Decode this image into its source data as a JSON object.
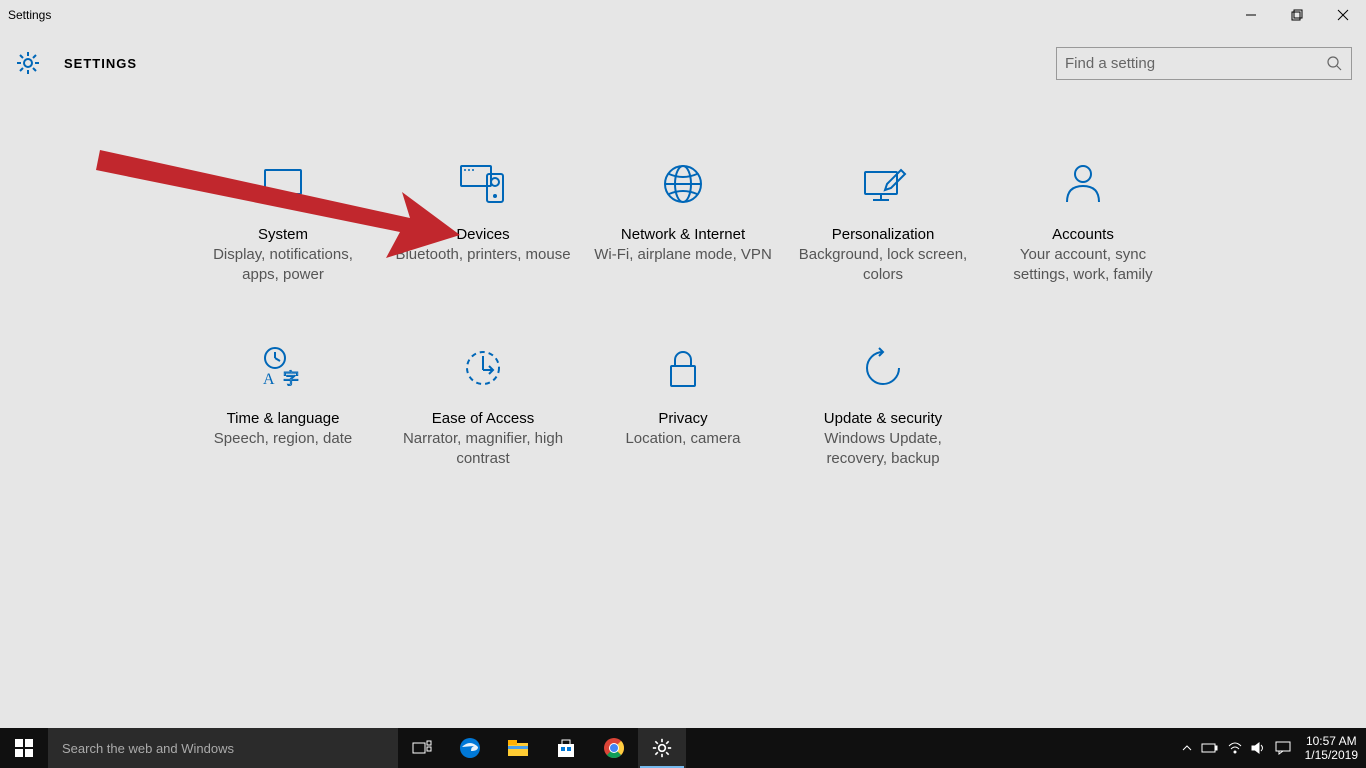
{
  "window": {
    "title": "Settings"
  },
  "header": {
    "app_title": "SETTINGS"
  },
  "search": {
    "placeholder": "Find a setting"
  },
  "colors": {
    "accent": "#0067b8"
  },
  "tiles": [
    {
      "id": "system",
      "title": "System",
      "desc": "Display, notifications, apps, power",
      "icon": "monitor"
    },
    {
      "id": "devices",
      "title": "Devices",
      "desc": "Bluetooth, printers, mouse",
      "icon": "devices"
    },
    {
      "id": "network",
      "title": "Network & Internet",
      "desc": "Wi-Fi, airplane mode, VPN",
      "icon": "globe"
    },
    {
      "id": "personalization",
      "title": "Personalization",
      "desc": "Background, lock screen, colors",
      "icon": "pen-monitor"
    },
    {
      "id": "accounts",
      "title": "Accounts",
      "desc": "Your account, sync settings, work, family",
      "icon": "person"
    },
    {
      "id": "time-language",
      "title": "Time & language",
      "desc": "Speech, region, date",
      "icon": "clock-letter"
    },
    {
      "id": "ease-of-access",
      "title": "Ease of Access",
      "desc": "Narrator, magnifier, high contrast",
      "icon": "dashed-arrow"
    },
    {
      "id": "privacy",
      "title": "Privacy",
      "desc": "Location, camera",
      "icon": "lock"
    },
    {
      "id": "update-security",
      "title": "Update & security",
      "desc": "Windows Update, recovery, backup",
      "icon": "sync"
    }
  ],
  "taskbar": {
    "search_placeholder": "Search the web and Windows",
    "items": [
      {
        "id": "task-view",
        "icon": "task-view"
      },
      {
        "id": "edge",
        "icon": "edge"
      },
      {
        "id": "file-explorer",
        "icon": "file-explorer"
      },
      {
        "id": "store",
        "icon": "store"
      },
      {
        "id": "chrome",
        "icon": "chrome"
      },
      {
        "id": "settings",
        "icon": "settings",
        "active": true
      }
    ],
    "tray": [
      "chevron-up",
      "battery",
      "wifi",
      "volume",
      "action-center"
    ],
    "clock": {
      "time": "10:57 AM",
      "date": "1/15/2019"
    }
  },
  "annotation": {
    "type": "arrow",
    "target": "devices"
  }
}
